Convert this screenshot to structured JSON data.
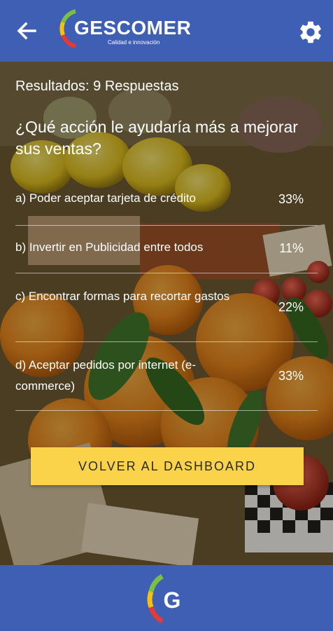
{
  "header": {
    "brand": "GESCOMER",
    "tagline": "Calidad e innovación",
    "back_icon": "arrow-left-icon",
    "settings_icon": "gear-icon"
  },
  "results": {
    "count_label": "Resultados: 9 Respuestas",
    "question": "¿Qué acción le ayudaría más a mejorar sus ventas?",
    "answers": [
      {
        "label": "a) Poder aceptar tarjeta de crédito",
        "percent": "33%"
      },
      {
        "label": "b) Invertir en Publicidad entre todos",
        "percent": "11%"
      },
      {
        "label": "c) Encontrar formas para recortar gastos",
        "percent": "22%"
      },
      {
        "label": "d) Aceptar pedidos por internet (e-commerce)",
        "percent": "33%"
      }
    ]
  },
  "actions": {
    "dashboard_label": "VOLVER AL DASHBOARD"
  },
  "footer": {
    "logo_letter": "G",
    "logo_icon": "gescomer-logo-icon"
  },
  "colors": {
    "primary_blue": "#3f5fb4",
    "accent_yellow": "#fbd34a",
    "logo_green": "#7ac143",
    "logo_yellow": "#f4c20d",
    "logo_red": "#e53935"
  }
}
